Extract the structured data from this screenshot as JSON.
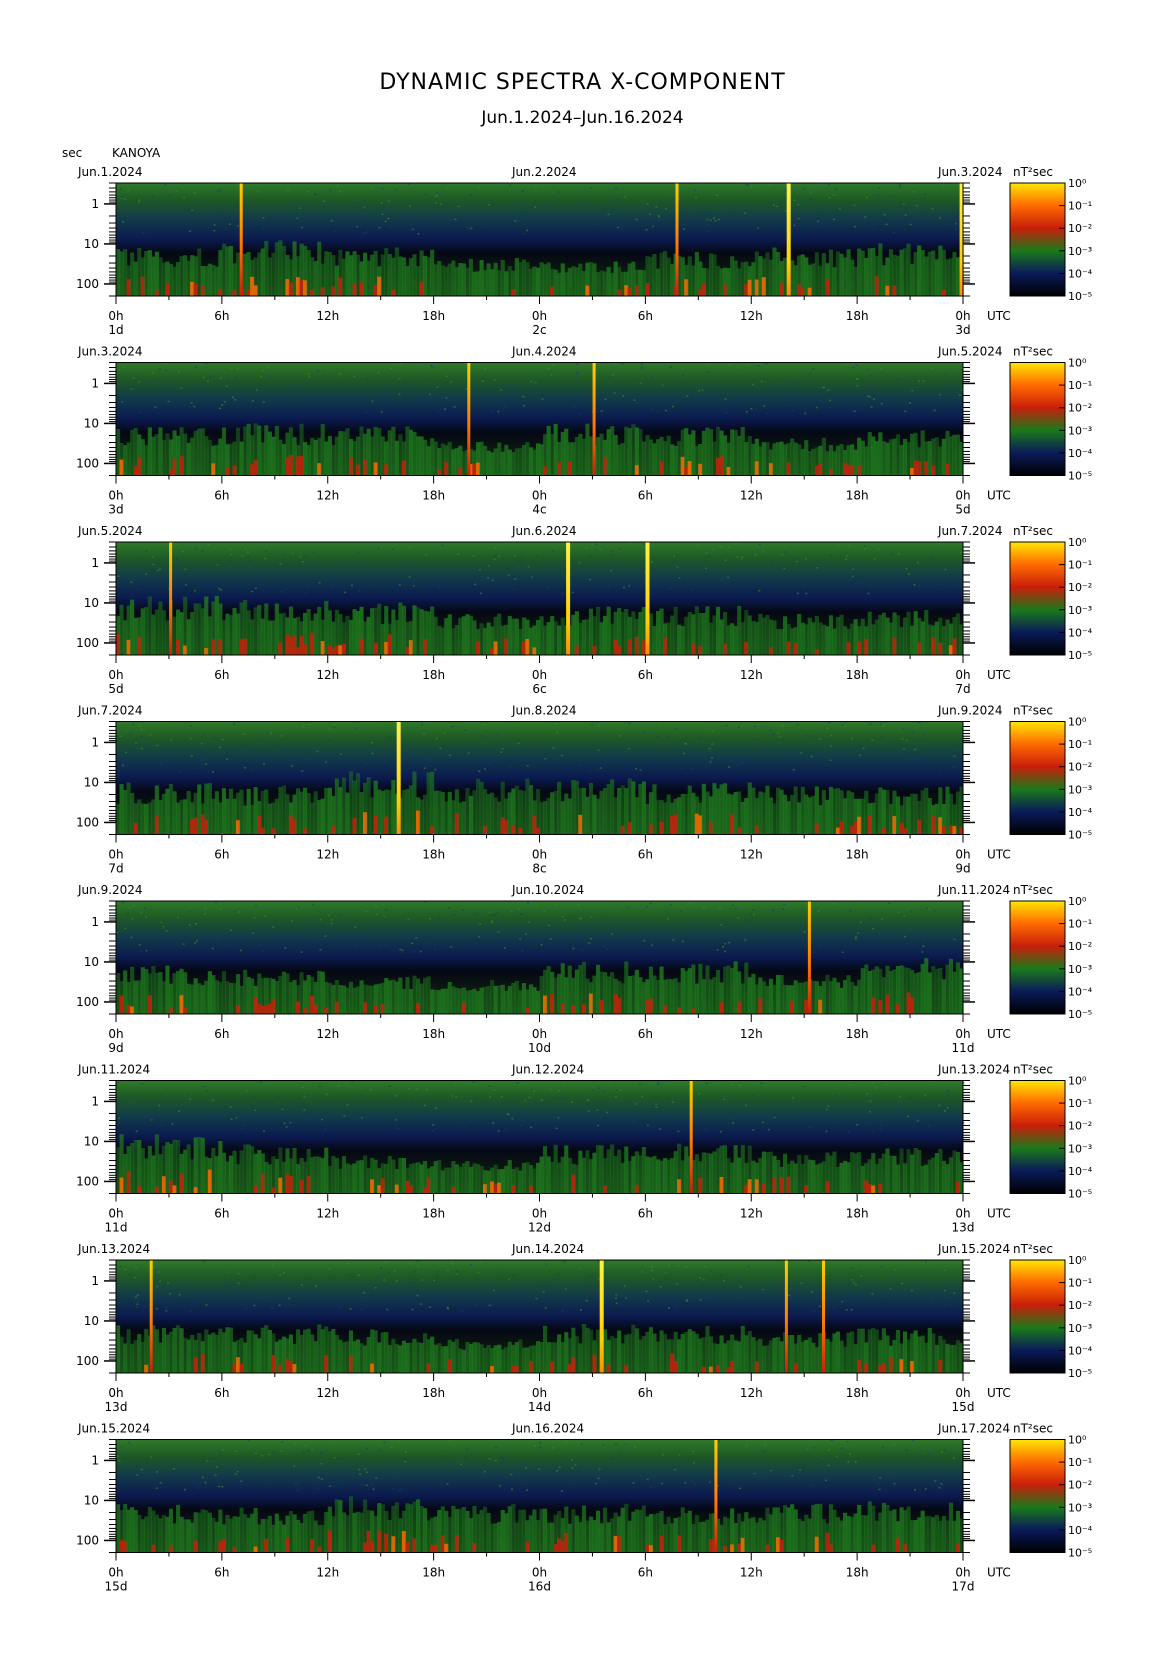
{
  "title": "DYNAMIC SPECTRA X-COMPONENT",
  "subtitle": "Jun.1.2024–Jun.16.2024",
  "axis_unit": "sec",
  "station": "KANOYA",
  "colors": {
    "colormap": [
      "#000000",
      "#0a1a5a",
      "#1a7a1a",
      "#c81e0a",
      "#ff6a00",
      "#ffe600"
    ],
    "background": "#ffffff"
  },
  "chart_data": {
    "type": "heatmap",
    "x_unit": "UTC",
    "y_unit": "sec",
    "y_ticks": [
      "1",
      "10",
      "100"
    ],
    "y_scale": "log",
    "x_ticks": [
      "0h",
      "6h",
      "12h",
      "18h",
      "0h",
      "6h",
      "12h",
      "18h",
      "0h"
    ],
    "colorbar": {
      "label": "nT²sec",
      "ticks": [
        "10⁰",
        "10⁻¹",
        "10⁻²",
        "10⁻³",
        "10⁻⁴",
        "10⁻⁵"
      ]
    },
    "panels": [
      {
        "date_left": "Jun.1.2024",
        "date_mid": "Jun.2.2024",
        "date_right": "Jun.3.2024",
        "day_left": "1d",
        "day_mid": "2c",
        "day_right": "3d",
        "activity": [
          0.5,
          0.6,
          0.5,
          0.35,
          0.3,
          0.45,
          0.5,
          0.55
        ],
        "spikes": [
          {
            "hour": 7.1,
            "color": "orange"
          },
          {
            "hour": 31.8,
            "color": "orange"
          },
          {
            "hour": 38.1,
            "color": "yellow"
          },
          {
            "hour": 47.9,
            "color": "yellow"
          }
        ]
      },
      {
        "date_left": "Jun.3.2024",
        "date_mid": "Jun.4.2024",
        "date_right": "Jun.5.2024",
        "day_left": "3d",
        "day_mid": "4c",
        "day_right": "5d",
        "activity": [
          0.5,
          0.55,
          0.5,
          0.3,
          0.55,
          0.5,
          0.35,
          0.45
        ],
        "spikes": [
          {
            "hour": 20.0,
            "color": "orange"
          },
          {
            "hour": 27.1,
            "color": "orange"
          }
        ]
      },
      {
        "date_left": "Jun.5.2024",
        "date_mid": "Jun.6.2024",
        "date_right": "Jun.7.2024",
        "day_left": "5d",
        "day_mid": "6c",
        "day_right": "7d",
        "activity": [
          0.65,
          0.6,
          0.55,
          0.4,
          0.5,
          0.5,
          0.4,
          0.45
        ],
        "spikes": [
          {
            "hour": 3.1,
            "color": "orange"
          },
          {
            "hour": 25.6,
            "color": "yellow"
          },
          {
            "hour": 30.1,
            "color": "yellow"
          }
        ]
      },
      {
        "date_left": "Jun.7.2024",
        "date_mid": "Jun.8.2024",
        "date_right": "Jun.9.2024",
        "day_left": "7d",
        "day_mid": "8c",
        "day_right": "9d",
        "activity": [
          0.55,
          0.5,
          0.7,
          0.6,
          0.6,
          0.55,
          0.5,
          0.5
        ],
        "spikes": [
          {
            "hour": 16.0,
            "color": "yellow"
          }
        ]
      },
      {
        "date_left": "Jun.9.2024",
        "date_mid": "Jun.10.2024",
        "date_right": "Jun.11.2024",
        "day_left": "9d",
        "day_mid": "10d",
        "day_right": "11d",
        "activity": [
          0.5,
          0.45,
          0.35,
          0.3,
          0.55,
          0.55,
          0.4,
          0.6
        ],
        "spikes": [
          {
            "hour": 39.3,
            "color": "orange"
          }
        ]
      },
      {
        "date_left": "Jun.11.2024",
        "date_mid": "Jun.12.2024",
        "date_right": "Jun.13.2024",
        "day_left": "11d",
        "day_mid": "12d",
        "day_right": "13d",
        "activity": [
          0.65,
          0.5,
          0.35,
          0.3,
          0.5,
          0.55,
          0.4,
          0.45
        ],
        "spikes": [
          {
            "hour": 32.6,
            "color": "orange"
          }
        ]
      },
      {
        "date_left": "Jun.13.2024",
        "date_mid": "Jun.14.2024",
        "date_right": "Jun.15.2024",
        "day_left": "13d",
        "day_mid": "14d",
        "day_right": "15d",
        "activity": [
          0.5,
          0.5,
          0.45,
          0.3,
          0.5,
          0.5,
          0.4,
          0.45
        ],
        "spikes": [
          {
            "hour": 2.0,
            "color": "orange"
          },
          {
            "hour": 27.5,
            "color": "yellow"
          },
          {
            "hour": 38.0,
            "color": "orange"
          },
          {
            "hour": 40.1,
            "color": "orange"
          }
        ]
      },
      {
        "date_left": "Jun.15.2024",
        "date_mid": "Jun.16.2024",
        "date_right": "Jun.17.2024",
        "day_left": "15d",
        "day_mid": "16d",
        "day_right": "17d",
        "activity": [
          0.5,
          0.45,
          0.6,
          0.5,
          0.5,
          0.45,
          0.5,
          0.55
        ],
        "spikes": [
          {
            "hour": 34.0,
            "color": "orange"
          }
        ]
      }
    ]
  }
}
